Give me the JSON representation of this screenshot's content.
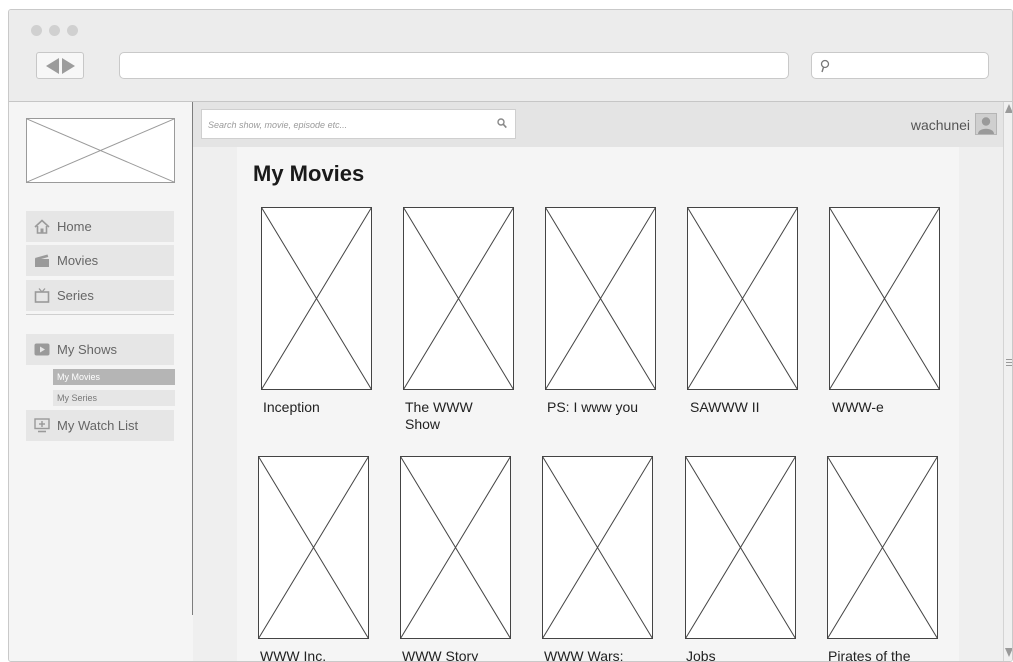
{
  "browser": {
    "url": "",
    "search_value": ""
  },
  "sidebar": {
    "logo": "image-placeholder",
    "items": [
      {
        "label": "Home",
        "icon": "home-icon"
      },
      {
        "label": "Movies",
        "icon": "clapperboard-icon"
      },
      {
        "label": "Series",
        "icon": "tv-icon"
      }
    ],
    "my_shows": {
      "label": "My Shows",
      "icon": "play-icon"
    },
    "sub_items": [
      {
        "label": "My Movies",
        "active": true
      },
      {
        "label": "My Series",
        "active": false
      }
    ],
    "watch_list": {
      "label": "My Watch List",
      "icon": "watchlist-icon"
    }
  },
  "appbar": {
    "search_placeholder": "Search show, movie, episode etc...",
    "username": "wachunei"
  },
  "main": {
    "title": "My Movies",
    "movies": [
      {
        "title": "Inception"
      },
      {
        "title": "The WWW Show"
      },
      {
        "title": "PS: I www you"
      },
      {
        "title": "SAWWW II"
      },
      {
        "title": "WWW-e"
      },
      {
        "title": "WWW Inc."
      },
      {
        "title": "WWW Story"
      },
      {
        "title": "WWW Wars:"
      },
      {
        "title": "Jobs"
      },
      {
        "title": "Pirates of the"
      }
    ]
  }
}
